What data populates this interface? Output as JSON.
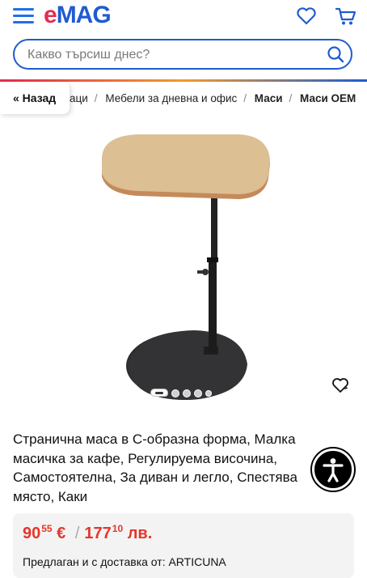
{
  "header": {
    "logo_e": "e",
    "logo_rest": "MAG",
    "icons": {
      "menu": "hamburger-menu-icon",
      "favorites": "heart-icon",
      "cart": "cart-icon"
    }
  },
  "search": {
    "placeholder": "Какво търсиш днес?",
    "value": ""
  },
  "breadcrumb": {
    "back_label": "« Назад",
    "items": [
      "аци",
      "Мебели за дневна и офис",
      "Маси",
      "Маси OEM"
    ]
  },
  "gallery": {
    "image_count": 4,
    "active_index": 0
  },
  "product": {
    "title": "Странична маса в С-образна форма, Малка масичка за кафе, Регулируема височина, Самостоятелна, За диван и легло, Спестява място, Каки"
  },
  "price": {
    "current_int": "90",
    "current_dec": "55",
    "current_cur": "€",
    "separator": "/",
    "alt_int": "177",
    "alt_dec": "10",
    "alt_cur": "лв."
  },
  "seller": {
    "text": "Предлаган и с доставка от: ARTICUNA"
  },
  "colors": {
    "brand_blue": "#1f5bd1",
    "brand_red": "#e52b50",
    "price_red": "#e5352b"
  }
}
